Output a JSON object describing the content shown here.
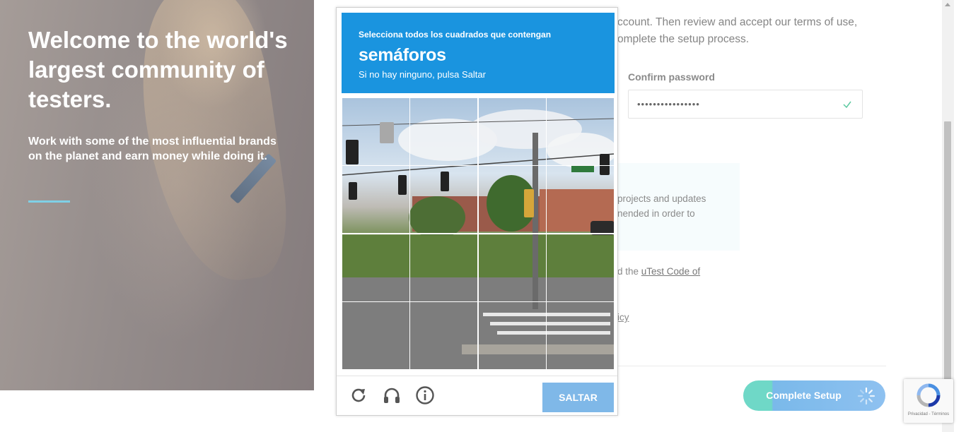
{
  "hero": {
    "title": "Welcome to the world's largest community of testers.",
    "subtitle": "Work with some of the most influential brands on the planet and earn money while doing it."
  },
  "form": {
    "intro_text": "ccount. Then review and accept our terms of use, omplete the setup process.",
    "confirm_password_label": "Confirm password",
    "confirm_password_value": "••••••••••••••••",
    "info_text": "projects and updates nended in order to",
    "code_prefix": "d the ",
    "code_link": "uTest Code of",
    "policy_fragment": "icy",
    "complete_button": "Complete Setup"
  },
  "captcha": {
    "instruction": "Selecciona todos los cuadrados que contengan",
    "object": "semáforos",
    "skip_hint": "Si no hay ninguno, pulsa Saltar",
    "skip_button": "SALTAR",
    "icons": [
      "reload-icon",
      "audio-icon",
      "info-icon"
    ]
  },
  "recaptcha_badge": {
    "terms": "Privacidad - Términos"
  },
  "colors": {
    "captcha_header": "#1a94df",
    "skip_button": "#7fb8e8",
    "accent_teal": "#6fd8c7",
    "accent_blue": "#7ab9ea",
    "hero_rule": "#7fd0e6"
  }
}
